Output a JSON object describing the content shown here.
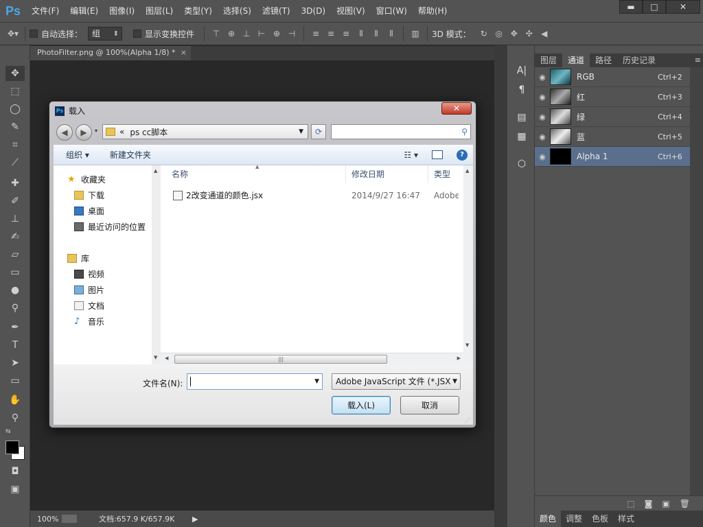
{
  "app": {
    "logo": "Ps"
  },
  "menu": [
    "文件(F)",
    "编辑(E)",
    "图像(I)",
    "图层(L)",
    "类型(Y)",
    "选择(S)",
    "滤镜(T)",
    "3D(D)",
    "视图(V)",
    "窗口(W)",
    "帮助(H)"
  ],
  "window_controls": {
    "minimize": "▬",
    "maximize": "□",
    "close": "✕"
  },
  "options": {
    "auto_select_label": "自动选择：",
    "auto_select_value": "组",
    "show_transform_label": "显示变换控件",
    "mode_3d_label": "3D 模式："
  },
  "document_tab": {
    "title": "PhotoFilter.png @ 100%(Alpha 1/8) *",
    "close": "×"
  },
  "status": {
    "zoom": "100%",
    "doc_info": "文档:657.9 K/657.9K",
    "arrow": "▶"
  },
  "panel": {
    "tabs": [
      "图层",
      "通道",
      "路径",
      "历史记录"
    ],
    "active_tab": "通道",
    "channels": [
      {
        "name": "RGB",
        "shortcut": "Ctrl+2",
        "selected": false
      },
      {
        "name": "红",
        "shortcut": "Ctrl+3",
        "selected": false
      },
      {
        "name": "绿",
        "shortcut": "Ctrl+4",
        "selected": false
      },
      {
        "name": "蓝",
        "shortcut": "Ctrl+5",
        "selected": false
      },
      {
        "name": "Alpha 1",
        "shortcut": "Ctrl+6",
        "selected": true
      }
    ],
    "bottom_tabs": [
      "颜色",
      "调整",
      "色板",
      "样式"
    ]
  },
  "dialog": {
    "title": "载入",
    "close": "✕",
    "address": {
      "prefix": "«",
      "path": "ps cc脚本"
    },
    "toolbar": {
      "organize": "组织 ▾",
      "new_folder": "新建文件夹"
    },
    "nav": {
      "favorites": "收藏夹",
      "favorites_items": [
        "下载",
        "桌面",
        "最近访问的位置"
      ],
      "library": "库",
      "library_items": [
        "视频",
        "图片",
        "文档",
        "音乐"
      ]
    },
    "columns": {
      "name": "名称",
      "date": "修改日期",
      "type": "类型"
    },
    "files": [
      {
        "name": "2改变通道的颜色.jsx",
        "date": "2014/9/27 16:47",
        "type": "Adobe"
      }
    ],
    "filename_label": "文件名(N):",
    "filename_value": "",
    "filetype": "Adobe JavaScript 文件 (*.JSX",
    "buttons": {
      "load": "载入(L)",
      "cancel": "取消"
    }
  }
}
